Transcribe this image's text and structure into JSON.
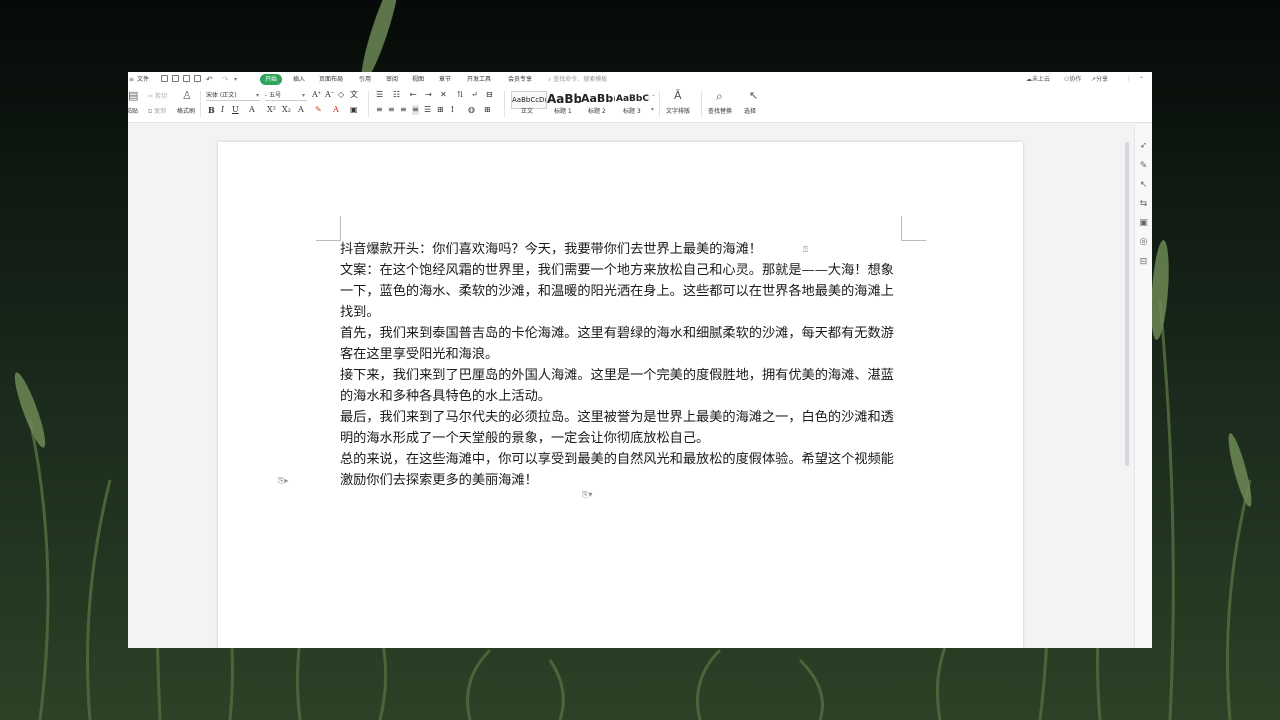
{
  "menubar": {
    "file": "文件",
    "tabs": [
      "开始",
      "插入",
      "页面布局",
      "引用",
      "审阅",
      "视图",
      "章节",
      "开发工具",
      "会员专享"
    ],
    "search_placeholder": "查找命令、搜索模板",
    "right": {
      "cloud": "未上云",
      "collab": "协作",
      "share": "分享"
    }
  },
  "ribbon": {
    "paste": "粘贴",
    "cut": "剪切",
    "copy": "复制",
    "format_painter": "格式刷",
    "font_name": "宋体 (正文)",
    "font_size": "五号",
    "styles": [
      {
        "preview": "AaBbCcDd",
        "label": "正文"
      },
      {
        "preview": "AaBb",
        "label": "标题 1"
      },
      {
        "preview": "AaBb(",
        "label": "标题 2"
      },
      {
        "preview": "AaBbC(",
        "label": "标题 3"
      }
    ],
    "text_layout": "文字排版",
    "find_replace": "查找替换",
    "select": "选择"
  },
  "document": {
    "paragraphs": [
      "抖音爆款开头：你们喜欢海吗？今天，我要带你们去世界上最美的海滩！",
      "文案：在这个饱经风霜的世界里，我们需要一个地方来放松自己和心灵。那就是——大海！想象一下，蓝色的海水、柔软的沙滩，和温暖的阳光洒在身上。这些都可以在世界各地最美的海滩上找到。",
      "首先，我们来到泰国普吉岛的卡伦海滩。这里有碧绿的海水和细腻柔软的沙滩，每天都有无数游客在这里享受阳光和海浪。",
      "接下来，我们来到了巴厘岛的外国人海滩。这里是一个完美的度假胜地，拥有优美的海滩、湛蓝的海水和多种各具特色的水上活动。",
      "最后，我们来到了马尔代夫的必须拉岛。这里被誉为是世界上最美的海滩之一，白色的沙滩和透明的海水形成了一个天堂般的景象，一定会让你彻底放松自己。",
      "总的来说，在这些海滩中，你可以享受到最美的自然风光和最放松的度假体验。希望这个视频能激励你们去探索更多的美丽海滩！"
    ]
  },
  "colors": {
    "accent_green": "#2fa35c",
    "page": "#ffffff",
    "workspace": "#f2f3f5"
  }
}
